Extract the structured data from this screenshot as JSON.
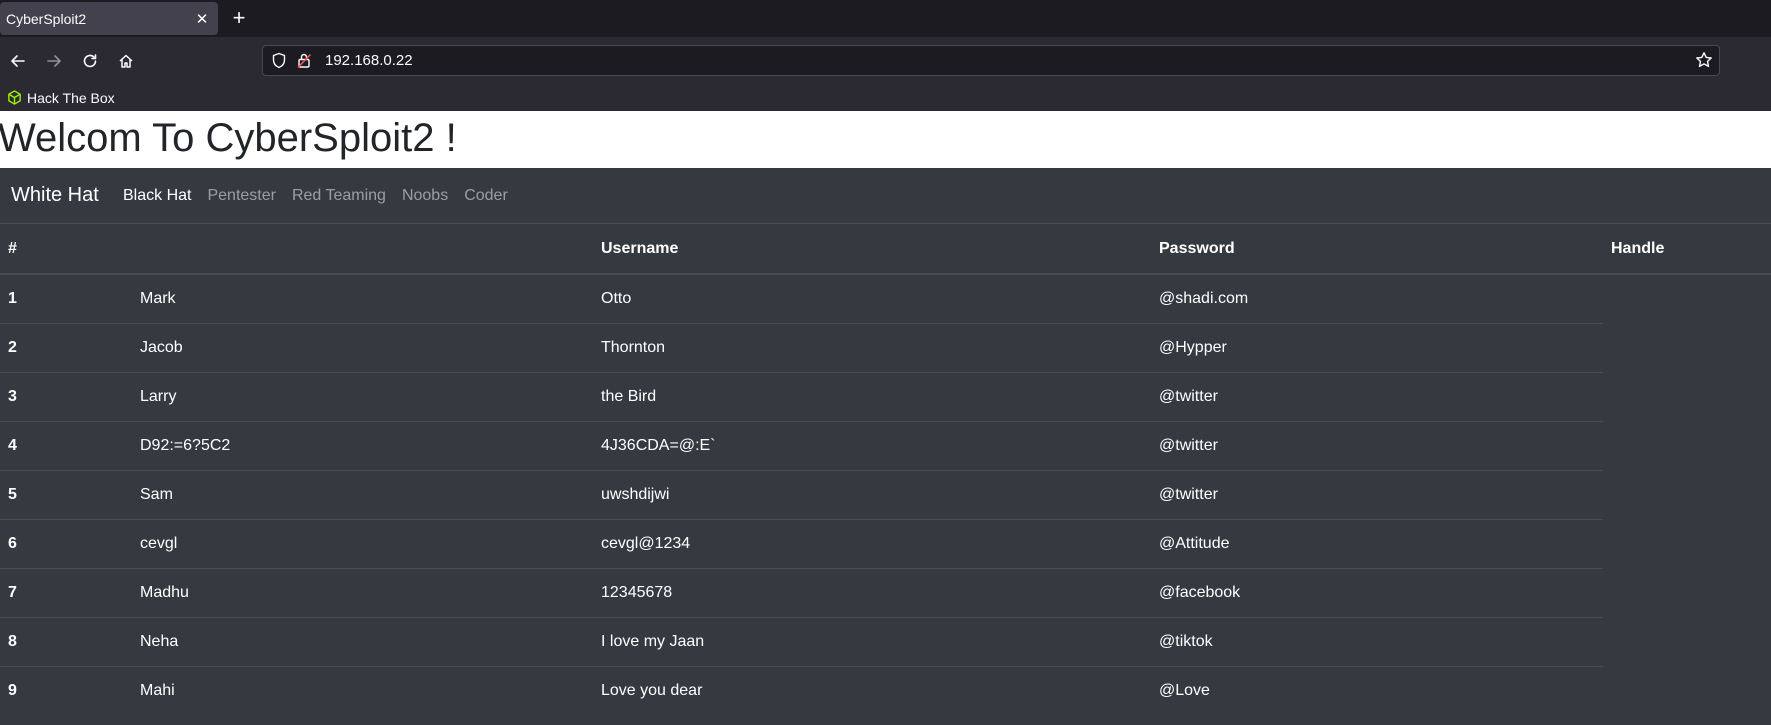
{
  "browser": {
    "tab_title": "CyberSploit2",
    "tab_close": "✕",
    "new_tab": "+",
    "url": "192.168.0.22",
    "bookmark": "Hack The Box"
  },
  "page": {
    "title": "Welcom To CyberSploit2 !"
  },
  "nav": {
    "brand": "White Hat",
    "links": [
      "Black Hat",
      "Pentester",
      "Red Teaming",
      "Noobs",
      "Coder"
    ]
  },
  "table": {
    "headers": [
      "#",
      "",
      "Username",
      "Password",
      "Handle"
    ],
    "rows": [
      [
        "1",
        "Mark",
        "Otto",
        "@shadi.com"
      ],
      [
        "2",
        "Jacob",
        "Thornton",
        "@Hypper"
      ],
      [
        "3",
        "Larry",
        "the Bird",
        "@twitter"
      ],
      [
        "4",
        "D92:=6?5C2",
        "4J36CDA=@:E`",
        "@twitter"
      ],
      [
        "5",
        "Sam",
        "uwshdijwi",
        "@twitter"
      ],
      [
        "6",
        "cevgl",
        "cevgl@1234",
        "@Attitude"
      ],
      [
        "7",
        "Madhu",
        "12345678",
        "@facebook"
      ],
      [
        "8",
        "Neha",
        "I love my Jaan",
        "@tiktok"
      ],
      [
        "9",
        "Mahi",
        "Love you dear",
        "@Love"
      ]
    ]
  },
  "colors": {
    "page_bg": "#343a40",
    "header_bg": "#ffffff",
    "border": "#454d55",
    "bookmark_icon": "#9fef00"
  }
}
